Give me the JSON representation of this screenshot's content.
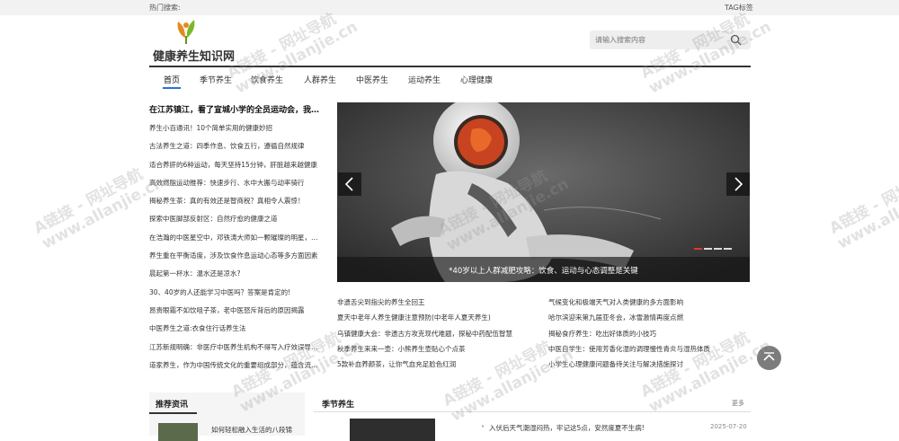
{
  "topbar": {
    "hot_search": "热门搜索:",
    "tag": "TAG标签"
  },
  "logo": {
    "name": "健康养生知识网"
  },
  "search": {
    "placeholder": "请输入搜索内容",
    "icon": "search-icon"
  },
  "nav": {
    "items": [
      "首页",
      "季节养生",
      "饮食养生",
      "人群养生",
      "中医养生",
      "运动养生",
      "心理健康"
    ],
    "active_index": 0,
    "accent": "#2a6fdb"
  },
  "news": {
    "headline": "在江苏镇江，看了宣城小学的全员运动会，我…",
    "items": [
      "养生小百通讯！10个简单实用的健康妙招",
      "古法养生之道：四季作息、饮食五行，遵循自然规律",
      "适合养肝的6种运动，每天坚持15分钟，肝脏越来越健康",
      "高效燃脂运动推荐：快速步行、水中大搬与动率骑行",
      "揭秘养生茶：真的有效还是智商税？真相令人震惊！",
      "探索中医脚部反射区：自然疗愈的健康之道",
      "在浩瀚的中医星空中，邓铁涛大师如一颗璀璨的明星，…",
      "养生重在平衡适度，涉及饮食作息运动心态等多方面因素",
      "晨起第一杯水：温水还是凉水?",
      "30、40岁的人还能学习中医吗？答案是肯定的!",
      "昂贵眼霜不如饮咀子茶，老中医怒斥背后的原因揭露",
      "中医养生之道:衣食住行话养生法",
      "江苏新规明确：非医疗中医养生机构不得写入疗效误导…",
      "道家养生，作为中国传统文化的重要组成部分，蕴含流…"
    ]
  },
  "banner": {
    "caption": "*40岁以上人群减肥攻略：饮食、运动与心态调整是关键",
    "slide_count": 4,
    "active_slide": 0,
    "prev_icon": "chevron-left-icon",
    "next_icon": "chevron-right-icon"
  },
  "links": {
    "left": [
      "非遗舌尖到指尖的养生全回王",
      "夏天中老年人养生健康注意预防(中老年人夏天养生)",
      "乌镇健康大会：非遗古方攻克现代难题，探秘中药配伍智慧",
      "秋季养生来来一壶：小熊养生壶贴心个点茶",
      "5款补血养颜茶，让你气血充足脸色红润"
    ],
    "right": [
      "气候变化和极端天气对人类健康的多方面影响",
      "哈尔滨迎来第九届亚冬会，冰雪激情再度点燃",
      "揭秘食疗养生：吃出好体质的小技巧",
      "中医自学生：使用芳香化湿的调理慢性青炎与湿热体质",
      "小学生心理健康问题备待关注与解决措施探讨"
    ]
  },
  "back_to_top": {
    "icon": "chevron-up-icon"
  },
  "recommend": {
    "title": "推荐资讯",
    "item": "如何轻松融入生活的八段锦"
  },
  "season": {
    "title": "季节养生",
    "more": "更多",
    "item": "入伏后天气潮湿闷热，牢记这5点，安然度夏不生病!",
    "date": "2025-07-20"
  },
  "watermark": {
    "line1": "A链接 - 网址导航",
    "line2": "www.allanjie.cn"
  }
}
